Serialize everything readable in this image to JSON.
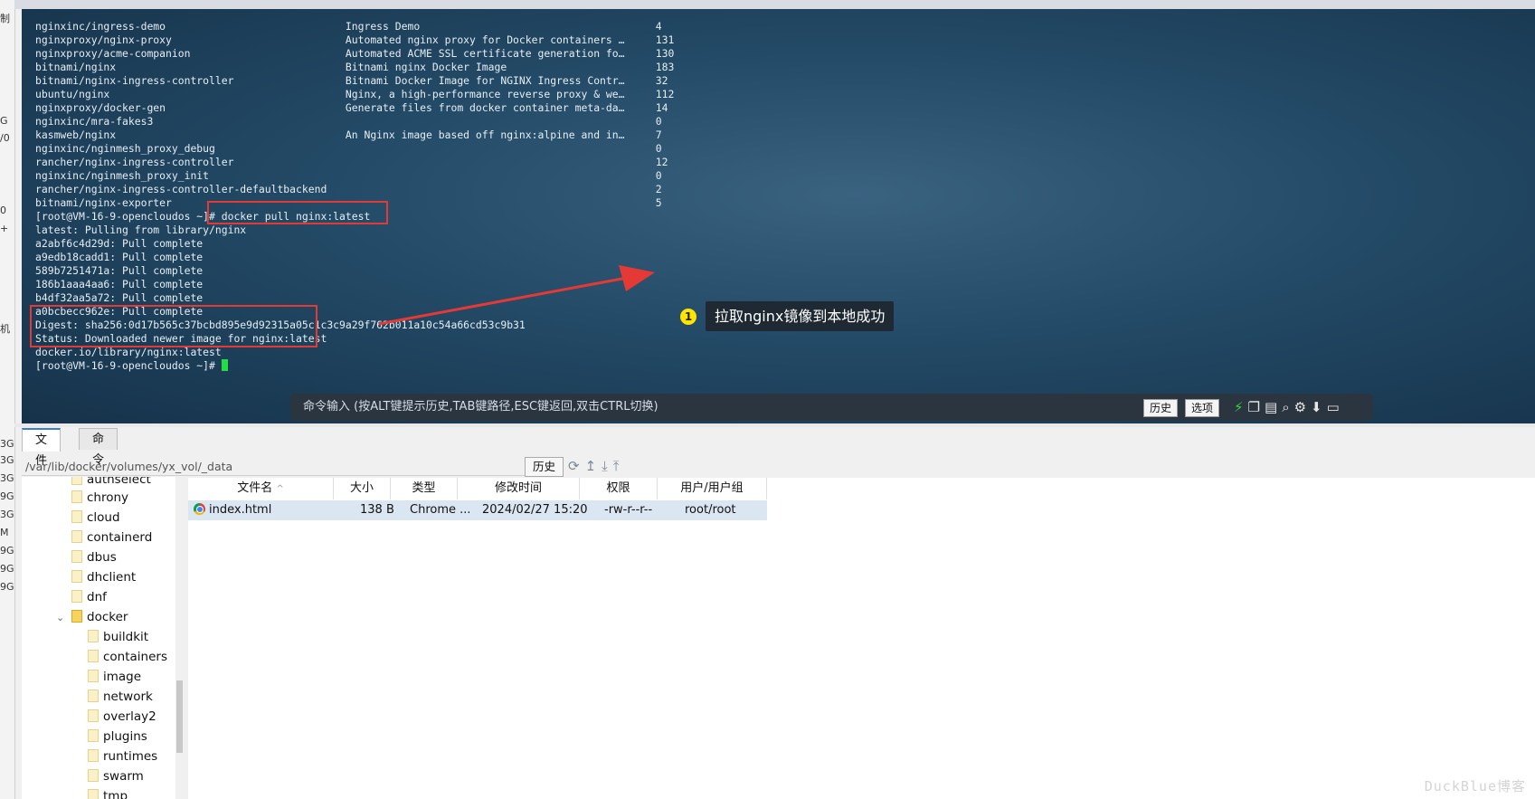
{
  "left_strip": [
    "制",
    "G",
    "/0",
    "0",
    "+",
    "机",
    "3G",
    "3G",
    "3G",
    "9G",
    "3G",
    "M",
    "9G",
    "9G",
    "9G"
  ],
  "terminal": {
    "lines": [
      "nginxinc/ingress-demo                             Ingress Demo                                      4",
      "nginxproxy/nginx-proxy                            Automated nginx proxy for Docker containers …     131",
      "nginxproxy/acme-companion                         Automated ACME SSL certificate generation fo…     130",
      "bitnami/nginx                                     Bitnami nginx Docker Image                        183",
      "bitnami/nginx-ingress-controller                  Bitnami Docker Image for NGINX Ingress Contr…     32",
      "ubuntu/nginx                                      Nginx, a high-performance reverse proxy & we…     112",
      "nginxproxy/docker-gen                             Generate files from docker container meta-da…     14",
      "nginxinc/mra-fakes3                                                                                 0",
      "kasmweb/nginx                                     An Nginx image based off nginx:alpine and in…     7",
      "nginxinc/nginmesh_proxy_debug                                                                       0",
      "rancher/nginx-ingress-controller                                                                    12",
      "nginxinc/nginmesh_proxy_init                                                                        0",
      "rancher/nginx-ingress-controller-defaultbackend                                                     2",
      "bitnami/nginx-exporter                                                                              5",
      "[root@VM-16-9-opencloudos ~]# docker pull nginx:latest",
      "latest: Pulling from library/nginx",
      "a2abf6c4d29d: Pull complete",
      "a9edb18cadd1: Pull complete",
      "589b7251471a: Pull complete",
      "186b1aaa4aa6: Pull complete",
      "b4df32aa5a72: Pull complete",
      "a0bcbecc962e: Pull complete",
      "Digest: sha256:0d17b565c37bcbd895e9d92315a05c1c3c9a29f762b011a10c54a66cd53c9b31",
      "Status: Downloaded newer image for nginx:latest",
      "docker.io/library/nginx:latest",
      "[root@VM-16-9-opencloudos ~]# "
    ],
    "callout_number": "1",
    "callout_text": "拉取nginx镜像到本地成功"
  },
  "command_bar": {
    "input_text": "命令输入 (按ALT键提示历史,TAB键路径,ESC键返回,双击CTRL切换)",
    "history_label": "历史",
    "options_label": "选项",
    "icons": [
      "flash-icon",
      "copy-icon",
      "paste-icon",
      "search-icon",
      "gear-icon",
      "download-icon",
      "window-icon"
    ]
  },
  "bottom_tabs": [
    {
      "label": "文件",
      "active": true
    },
    {
      "label": "命令",
      "active": false
    }
  ],
  "path_bar": {
    "path": "/var/lib/docker/volumes/yx_vol/_data",
    "history_label": "历史",
    "icons": [
      "refresh-icon",
      "up-icon",
      "download-icon",
      "upload-icon"
    ]
  },
  "tree": {
    "items": [
      {
        "label": "authselect",
        "level": 1
      },
      {
        "label": "chrony",
        "level": 1
      },
      {
        "label": "cloud",
        "level": 1
      },
      {
        "label": "containerd",
        "level": 1
      },
      {
        "label": "dbus",
        "level": 1
      },
      {
        "label": "dhclient",
        "level": 1
      },
      {
        "label": "dnf",
        "level": 1
      },
      {
        "label": "docker",
        "level": 1,
        "expanded": true
      },
      {
        "label": "buildkit",
        "level": 2
      },
      {
        "label": "containers",
        "level": 2
      },
      {
        "label": "image",
        "level": 2
      },
      {
        "label": "network",
        "level": 2
      },
      {
        "label": "overlay2",
        "level": 2
      },
      {
        "label": "plugins",
        "level": 2
      },
      {
        "label": "runtimes",
        "level": 2
      },
      {
        "label": "swarm",
        "level": 2
      },
      {
        "label": "tmp",
        "level": 2
      }
    ]
  },
  "file_table": {
    "columns": [
      "文件名",
      "大小",
      "类型",
      "修改时间",
      "权限",
      "用户/用户组"
    ],
    "rows": [
      {
        "name": "index.html",
        "size": "138 B",
        "type": "Chrome ...",
        "modified": "2024/02/27 15:20",
        "perms": "-rw-r--r--",
        "owner": "root/root"
      }
    ]
  },
  "watermark": "DuckBlue博客",
  "colors": {
    "highlight_box": "#e53935",
    "callout_badge": "#ffe600",
    "cursor": "#22dd44",
    "active_tab": "#3a7bd5"
  }
}
